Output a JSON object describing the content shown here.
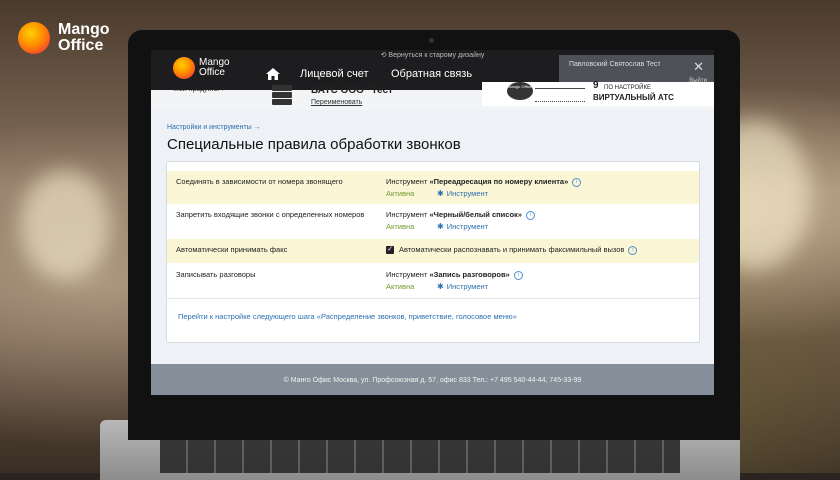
{
  "brand": {
    "line1": "Mango",
    "line2": "Office"
  },
  "topbar": {
    "tip": "⟲ Вернуться к старому дизайну",
    "logo_line1": "Mango",
    "logo_line2": "Office",
    "nav": [
      "Лицевой счет",
      "Обратная связь"
    ],
    "user_name": "Павловский Святослав Тест",
    "exit": "Выйти"
  },
  "subbar": {
    "products": "Мои продукты ▾",
    "company": "ВАТС ООО \"Тест\"",
    "rename": "Переименовать",
    "banner_number": "9",
    "banner_line1": "ПО НАСТРОЙКЕ",
    "banner_line2": "ВИРТУАЛЬНЫЙ АТС",
    "banner_logo": "Mango Office"
  },
  "breadcrumb": "Настройки и инструменты →",
  "page_title": "Специальные правила обработки звонков",
  "rules": [
    {
      "name": "Соединять в зависимости от номера звонящего",
      "tool_prefix": "Инструмент ",
      "tool_name": "«Переадресация по номеру клиента»",
      "status": "Активна",
      "link": "Инструмент",
      "highlight": true
    },
    {
      "name": "Запретить входящие звонки с определенных номеров",
      "tool_prefix": "Инструмент ",
      "tool_name": "«Черный/белый список»",
      "status": "Активна",
      "link": "Инструмент",
      "highlight": false
    },
    {
      "name": "Автоматически принимать факс",
      "checkbox_label": "Автоматически распознавать и принимать факсимильный вызов",
      "highlight": true
    },
    {
      "name": "Записывать разговоры",
      "tool_prefix": "Инструмент ",
      "tool_name": "«Запись разговоров»",
      "status": "Активна",
      "link": "Инструмент",
      "highlight": false
    }
  ],
  "next_step_link": "Перейти к настройке следующего шага «Распределение звонков, приветствие, голосовое меню»",
  "footer": "© Манго Офис Москва, ул. Профсоюзная д. 57, офис 833 Тел.: +7 495 540-44-44, 745-33-99",
  "icons": {
    "home": "home-icon",
    "info": "info-icon",
    "gear": "gear-icon",
    "close": "close-icon",
    "server": "server-icon"
  },
  "colors": {
    "accent_link": "#2a6fb0",
    "status_active": "#6f9a2c",
    "highlight_row": "#fbf6d6",
    "footer": "#848f99"
  }
}
